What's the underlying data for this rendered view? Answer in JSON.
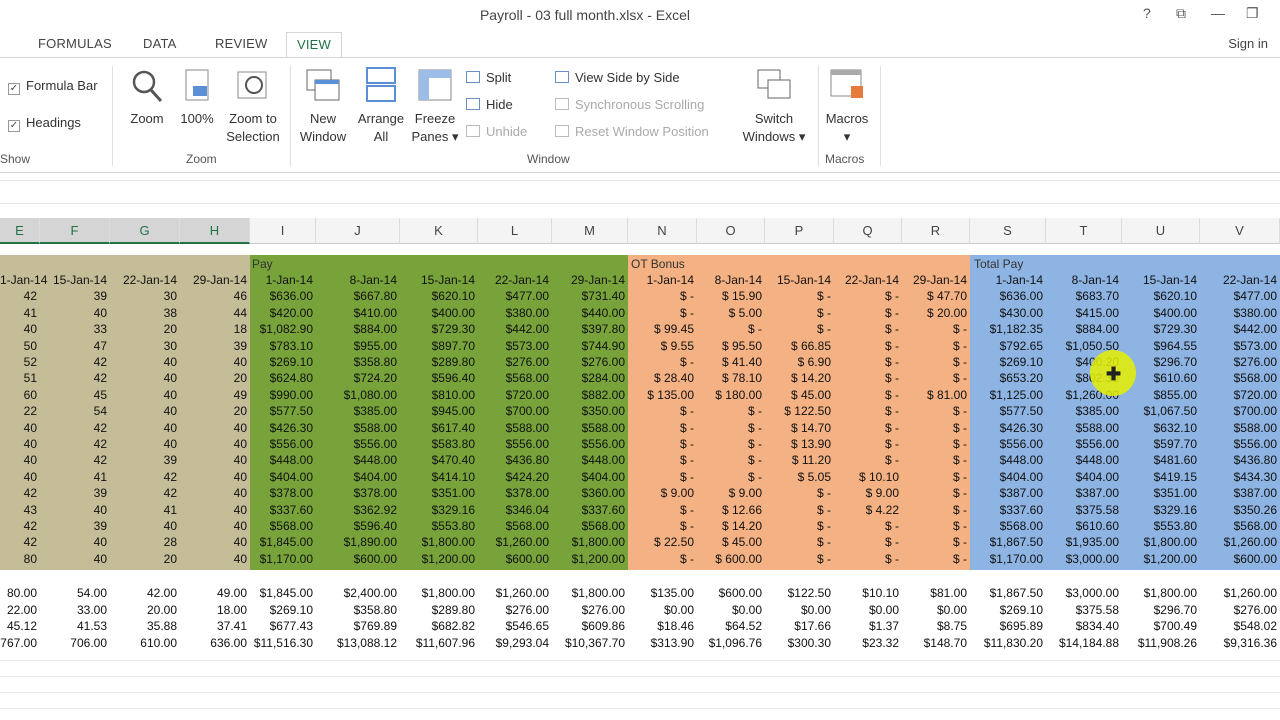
{
  "window": {
    "title": "Payroll - 03 full month.xlsx - Excel",
    "help": "?",
    "restore": "⧉",
    "minimize": "—",
    "maximize": "❐"
  },
  "tabs": [
    "FORMULAS",
    "DATA",
    "REVIEW",
    "VIEW"
  ],
  "signin": "Sign in",
  "ribbon": {
    "show": {
      "formula_bar": "Formula Bar",
      "headings": "Headings",
      "group": "Show"
    },
    "zoom": {
      "zoom": "Zoom",
      "hundred": "100%",
      "zoom_sel_1": "Zoom to",
      "zoom_sel_2": "Selection",
      "group": "Zoom"
    },
    "window": {
      "new_1": "New",
      "new_2": "Window",
      "arrange_1": "Arrange",
      "arrange_2": "All",
      "freeze_1": "Freeze",
      "freeze_2": "Panes ▾",
      "split": "Split",
      "hide": "Hide",
      "unhide": "Unhide",
      "side": "View Side by Side",
      "sync": "Synchronous Scrolling",
      "reset": "Reset Window Position",
      "switch_1": "Switch",
      "switch_2": "Windows ▾",
      "group": "Window"
    },
    "macros": {
      "label": "Macros",
      "arrow": "▾",
      "group": "Macros"
    }
  },
  "columns": [
    "E",
    "F",
    "G",
    "H",
    "I",
    "J",
    "K",
    "L",
    "M",
    "N",
    "O",
    "P",
    "Q",
    "R",
    "S",
    "T",
    "U",
    "V"
  ],
  "section_labels": {
    "pay": "Pay",
    "ot": "OT Bonus",
    "total": "Total Pay"
  },
  "dates": [
    "1-Jan-14",
    "15-Jan-14",
    "22-Jan-14",
    "29-Jan-14",
    "1-Jan-14",
    "8-Jan-14",
    "15-Jan-14",
    "22-Jan-14",
    "29-Jan-14",
    "1-Jan-14",
    "8-Jan-14",
    "15-Jan-14",
    "22-Jan-14",
    "29-Jan-14",
    "1-Jan-14",
    "8-Jan-14",
    "15-Jan-14",
    "22-Jan-14"
  ],
  "colors": {
    "hours": "#c4bd97",
    "pay": "#77a33a",
    "ot": "#f4b183",
    "total": "#8eb4e3"
  },
  "rows": [
    [
      "42",
      "39",
      "30",
      "46",
      "$636.00",
      "$667.80",
      "$620.10",
      "$477.00",
      "$731.40",
      "$   -",
      "$  15.90",
      "$   -",
      "$   -",
      "$  47.70",
      "$636.00",
      "$683.70",
      "$620.10",
      "$477.00"
    ],
    [
      "41",
      "40",
      "38",
      "44",
      "$420.00",
      "$410.00",
      "$400.00",
      "$380.00",
      "$440.00",
      "$   -",
      "$   5.00",
      "$   -",
      "$   -",
      "$  20.00",
      "$430.00",
      "$415.00",
      "$400.00",
      "$380.00"
    ],
    [
      "40",
      "33",
      "20",
      "18",
      "$1,082.90",
      "$884.00",
      "$729.30",
      "$442.00",
      "$397.80",
      "$  99.45",
      "$   -",
      "$   -",
      "$   -",
      "$   -",
      "$1,182.35",
      "$884.00",
      "$729.30",
      "$442.00"
    ],
    [
      "50",
      "47",
      "30",
      "39",
      "$783.10",
      "$955.00",
      "$897.70",
      "$573.00",
      "$744.90",
      "$   9.55",
      "$  95.50",
      "$  66.85",
      "$   -",
      "$   -",
      "$792.65",
      "$1,050.50",
      "$964.55",
      "$573.00"
    ],
    [
      "52",
      "42",
      "40",
      "40",
      "$269.10",
      "$358.80",
      "$289.80",
      "$276.00",
      "$276.00",
      "$   -",
      "$  41.40",
      "$   6.90",
      "$   -",
      "$   -",
      "$269.10",
      "$400.20",
      "$296.70",
      "$276.00"
    ],
    [
      "51",
      "42",
      "40",
      "20",
      "$624.80",
      "$724.20",
      "$596.40",
      "$568.00",
      "$284.00",
      "$  28.40",
      "$  78.10",
      "$  14.20",
      "$   -",
      "$   -",
      "$653.20",
      "$802.30",
      "$610.60",
      "$568.00"
    ],
    [
      "60",
      "45",
      "40",
      "49",
      "$990.00",
      "$1,080.00",
      "$810.00",
      "$720.00",
      "$882.00",
      "$ 135.00",
      "$ 180.00",
      "$  45.00",
      "$   -",
      "$  81.00",
      "$1,125.00",
      "$1,260.00",
      "$855.00",
      "$720.00"
    ],
    [
      "22",
      "54",
      "40",
      "20",
      "$577.50",
      "$385.00",
      "$945.00",
      "$700.00",
      "$350.00",
      "$   -",
      "$   -",
      "$ 122.50",
      "$   -",
      "$   -",
      "$577.50",
      "$385.00",
      "$1,067.50",
      "$700.00"
    ],
    [
      "40",
      "42",
      "40",
      "40",
      "$426.30",
      "$588.00",
      "$617.40",
      "$588.00",
      "$588.00",
      "$   -",
      "$   -",
      "$  14.70",
      "$   -",
      "$   -",
      "$426.30",
      "$588.00",
      "$632.10",
      "$588.00"
    ],
    [
      "40",
      "42",
      "40",
      "40",
      "$556.00",
      "$556.00",
      "$583.80",
      "$556.00",
      "$556.00",
      "$   -",
      "$   -",
      "$  13.90",
      "$   -",
      "$   -",
      "$556.00",
      "$556.00",
      "$597.70",
      "$556.00"
    ],
    [
      "40",
      "42",
      "39",
      "40",
      "$448.00",
      "$448.00",
      "$470.40",
      "$436.80",
      "$448.00",
      "$   -",
      "$   -",
      "$  11.20",
      "$   -",
      "$   -",
      "$448.00",
      "$448.00",
      "$481.60",
      "$436.80"
    ],
    [
      "40",
      "41",
      "42",
      "40",
      "$404.00",
      "$404.00",
      "$414.10",
      "$424.20",
      "$404.00",
      "$   -",
      "$   -",
      "$   5.05",
      "$  10.10",
      "$   -",
      "$404.00",
      "$404.00",
      "$419.15",
      "$434.30"
    ],
    [
      "42",
      "39",
      "42",
      "40",
      "$378.00",
      "$378.00",
      "$351.00",
      "$378.00",
      "$360.00",
      "$   9.00",
      "$   9.00",
      "$   -",
      "$   9.00",
      "$   -",
      "$387.00",
      "$387.00",
      "$351.00",
      "$387.00"
    ],
    [
      "43",
      "40",
      "41",
      "40",
      "$337.60",
      "$362.92",
      "$329.16",
      "$346.04",
      "$337.60",
      "$   -",
      "$  12.66",
      "$   -",
      "$   4.22",
      "$   -",
      "$337.60",
      "$375.58",
      "$329.16",
      "$350.26"
    ],
    [
      "42",
      "39",
      "40",
      "40",
      "$568.00",
      "$596.40",
      "$553.80",
      "$568.00",
      "$568.00",
      "$   -",
      "$  14.20",
      "$   -",
      "$   -",
      "$   -",
      "$568.00",
      "$610.60",
      "$553.80",
      "$568.00"
    ],
    [
      "42",
      "40",
      "28",
      "40",
      "$1,845.00",
      "$1,890.00",
      "$1,800.00",
      "$1,260.00",
      "$1,800.00",
      "$  22.50",
      "$  45.00",
      "$   -",
      "$   -",
      "$   -",
      "$1,867.50",
      "$1,935.00",
      "$1,800.00",
      "$1,260.00"
    ],
    [
      "80",
      "40",
      "20",
      "40",
      "$1,170.00",
      "$600.00",
      "$1,200.00",
      "$600.00",
      "$1,200.00",
      "$   -",
      "$ 600.00",
      "$   -",
      "$   -",
      "$   -",
      "$1,170.00",
      "$3,000.00",
      "$1,200.00",
      "$600.00"
    ]
  ],
  "summary": [
    [
      "80.00",
      "54.00",
      "42.00",
      "49.00",
      "$1,845.00",
      "$2,400.00",
      "$1,800.00",
      "$1,260.00",
      "$1,800.00",
      "$135.00",
      "$600.00",
      "$122.50",
      "$10.10",
      "$81.00",
      "$1,867.50",
      "$3,000.00",
      "$1,800.00",
      "$1,260.00"
    ],
    [
      "22.00",
      "33.00",
      "20.00",
      "18.00",
      "$269.10",
      "$358.80",
      "$289.80",
      "$276.00",
      "$276.00",
      "$0.00",
      "$0.00",
      "$0.00",
      "$0.00",
      "$0.00",
      "$269.10",
      "$375.58",
      "$296.70",
      "$276.00"
    ],
    [
      "45.12",
      "41.53",
      "35.88",
      "37.41",
      "$677.43",
      "$769.89",
      "$682.82",
      "$546.65",
      "$609.86",
      "$18.46",
      "$64.52",
      "$17.66",
      "$1.37",
      "$8.75",
      "$695.89",
      "$834.40",
      "$700.49",
      "$548.02"
    ],
    [
      "767.00",
      "706.00",
      "610.00",
      "636.00",
      "$11,516.30",
      "$13,088.12",
      "$11,607.96",
      "$9,293.04",
      "$10,367.70",
      "$313.90",
      "$1,096.76",
      "$300.30",
      "$23.32",
      "$148.70",
      "$11,830.20",
      "$14,184.88",
      "$11,908.26",
      "$9,316.36"
    ]
  ]
}
